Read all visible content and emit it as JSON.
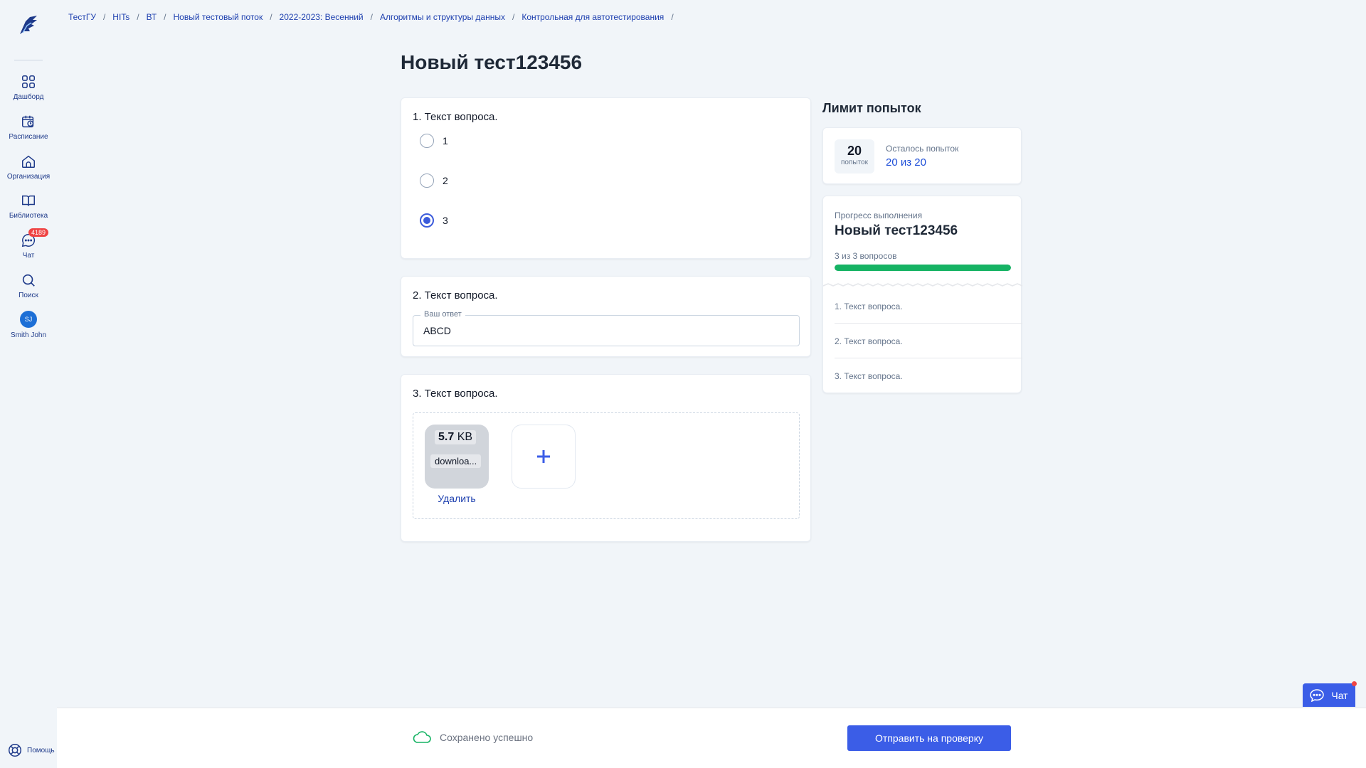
{
  "sidebar": {
    "items": [
      {
        "label": "Дашборд"
      },
      {
        "label": "Расписание"
      },
      {
        "label": "Организация"
      },
      {
        "label": "Библиотека"
      },
      {
        "label": "Чат",
        "badge": "4189"
      },
      {
        "label": "Поиск"
      },
      {
        "label": "Smith John",
        "initials": "SJ"
      }
    ],
    "help_label": "Помощь"
  },
  "breadcrumbs": [
    "ТестГУ",
    "HITs",
    "ВТ",
    "Новый тестовый поток",
    "2022-2023: Весенний",
    "Алгоритмы и структуры данных",
    "Контрольная для автотестирования"
  ],
  "page_title": "Новый тест123456",
  "questions": [
    {
      "title": "1. Текст вопроса.",
      "options": [
        {
          "label": "1",
          "checked": false
        },
        {
          "label": "2",
          "checked": false
        },
        {
          "label": "3",
          "checked": true
        }
      ]
    },
    {
      "title": "2. Текст вопроса.",
      "field_label": "Ваш ответ",
      "answer": "ABCD"
    },
    {
      "title": "3. Текст вопроса.",
      "file": {
        "size_value": "5.7",
        "size_unit": "KB",
        "name": "downloa..."
      },
      "delete_label": "Удалить",
      "add_symbol": "+"
    }
  ],
  "attempts": {
    "title": "Лимит попыток",
    "count": "20",
    "count_unit": "попыток",
    "remaining_label": "Осталось попыток",
    "remaining_value": "20 из 20"
  },
  "progress": {
    "caption": "Прогресс выполнения",
    "test_name": "Новый тест123456",
    "count_text": "3 из 3 вопросов",
    "fraction": 1.0,
    "questions": [
      "1. Текст вопроса.",
      "2. Текст вопроса.",
      "3. Текст вопроса."
    ]
  },
  "footer": {
    "saved_text": "Сохранено успешно",
    "submit_label": "Отправить на проверку"
  },
  "chat_widget": {
    "label": "Чат"
  },
  "colors": {
    "accent": "#3b5de7",
    "progress": "#16b364",
    "badge": "#ef4444",
    "link": "#1e40af"
  }
}
